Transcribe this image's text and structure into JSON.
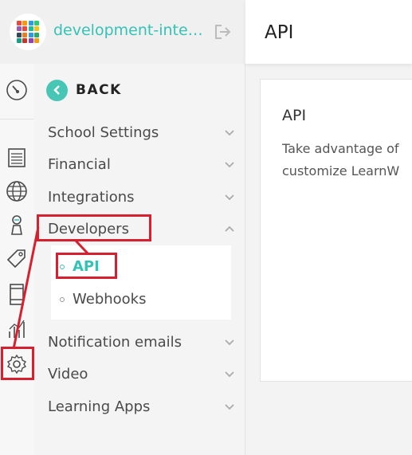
{
  "header": {
    "site_name": "development-integ...",
    "page_title": "API"
  },
  "logo_colors": [
    "#e84b3c",
    "#f39c12",
    "#3498db",
    "#2ecc71",
    "#9b59b6",
    "#e84b3c",
    "#1abc9c",
    "#f1c40f",
    "#34495e",
    "#e67e22",
    "#3498db",
    "#27ae60",
    "#16a085",
    "#c0392b",
    "#8e44ad",
    "#f39c12"
  ],
  "icon_rail": {
    "icons": [
      "dashboard-gauge-icon",
      "courses-list-icon",
      "globe-icon",
      "users-icon",
      "tag-icon",
      "mobile-page-icon",
      "reports-chart-icon",
      "settings-gear-icon"
    ]
  },
  "nav": {
    "back_label": "BACK",
    "items": [
      {
        "label": "School Settings",
        "expanded": false
      },
      {
        "label": "Financial",
        "expanded": false
      },
      {
        "label": "Integrations",
        "expanded": false
      },
      {
        "label": "Developers",
        "expanded": true
      },
      {
        "label": "Notification emails",
        "expanded": false
      },
      {
        "label": "Video",
        "expanded": false
      },
      {
        "label": "Learning Apps",
        "expanded": false
      }
    ],
    "submenu": [
      {
        "label": "API",
        "active": true
      },
      {
        "label": "Webhooks",
        "active": false
      }
    ]
  },
  "content": {
    "card_title": "API",
    "card_text_line1": "Take advantage of",
    "card_text_line2": "customize LearnW"
  },
  "colors": {
    "accent": "#35c2b6",
    "annotation": "#d6202f"
  }
}
